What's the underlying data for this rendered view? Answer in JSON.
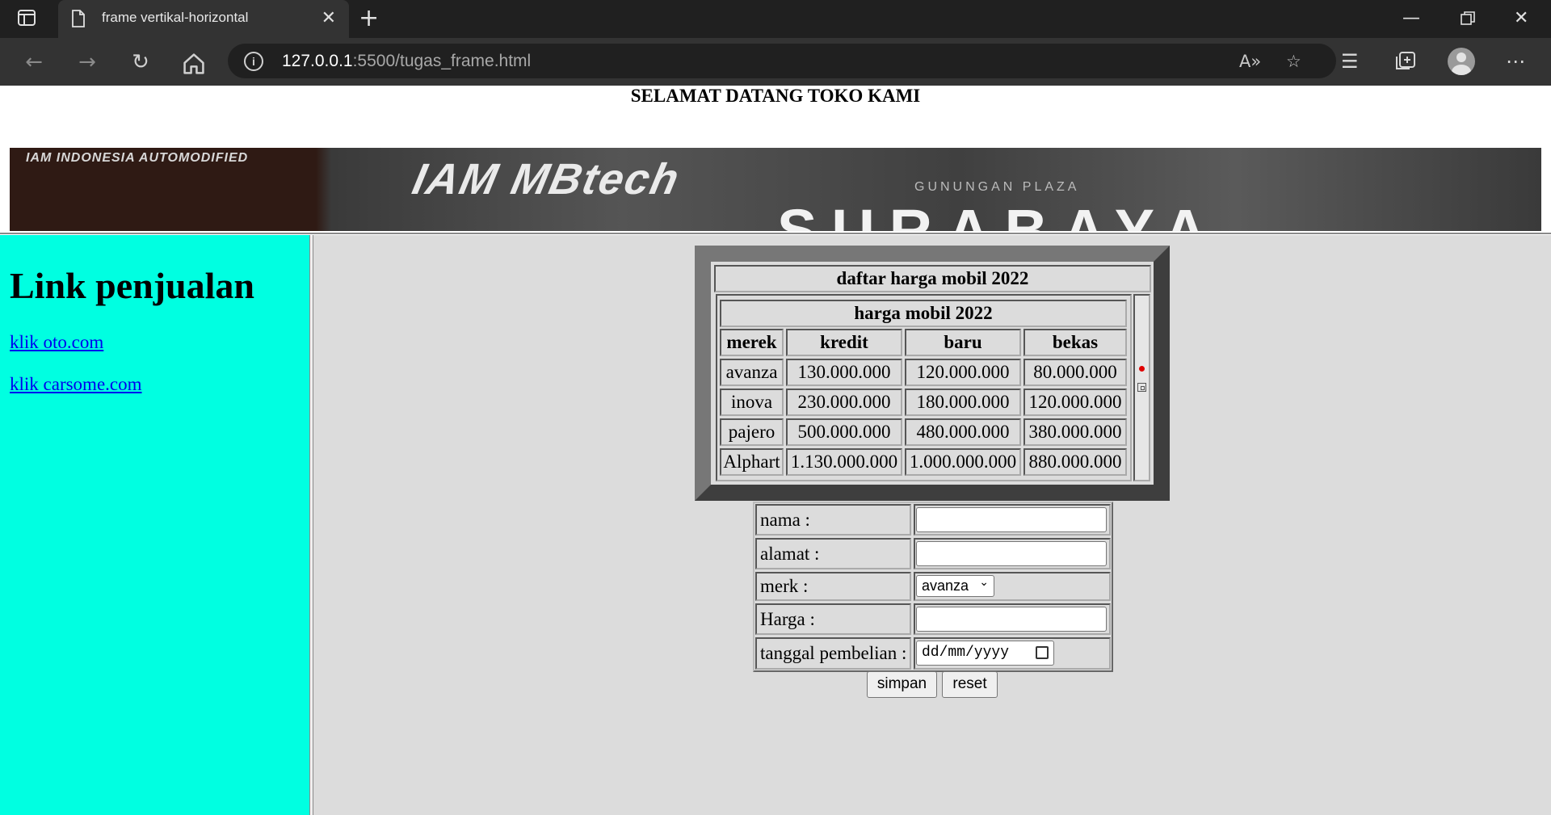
{
  "browser": {
    "tab_title": "frame vertikal-horizontal",
    "url_host": "127.0.0.1",
    "url_rest": ":5500/tugas_frame.html",
    "read_aloud_glyph": "A»"
  },
  "header": {
    "welcome": "SELAMAT DATANG TOKO KAMI",
    "banner_text_left": "IAM INDONESIA AUTOMODIFIED",
    "banner_text_mid": "IAM MBtech",
    "banner_text_small": "GUNUNGAN PLAZA",
    "banner_text_big": "SURABAYA"
  },
  "sidebar": {
    "heading": "Link penjualan",
    "links": [
      "klik oto.com",
      "klik carsome.com"
    ]
  },
  "price_table": {
    "caption": "daftar harga mobil 2022",
    "title": "harga mobil 2022",
    "columns": [
      "merek",
      "kredit",
      "baru",
      "bekas"
    ],
    "rows": [
      [
        "avanza",
        "130.000.000",
        "120.000.000",
        "80.000.000"
      ],
      [
        "inova",
        "230.000.000",
        "180.000.000",
        "120.000.000"
      ],
      [
        "pajero",
        "500.000.000",
        "480.000.000",
        "380.000.000"
      ],
      [
        "Alphart",
        "1.130.000.000",
        "1.000.000.000",
        "880.000.000"
      ]
    ]
  },
  "form": {
    "nama_label": "nama :",
    "nama_value": "",
    "alamat_label": "alamat :",
    "alamat_value": "",
    "merk_label": "merk :",
    "merk_selected": "avanza",
    "harga_label": "Harga :",
    "harga_value": "",
    "tanggal_label": "tanggal pembelian :",
    "tanggal_placeholder": "dd/mm/yyyy",
    "submit_label": "simpan",
    "reset_label": "reset"
  },
  "icons": [
    "sidebar-toggle-icon",
    "document-icon",
    "close-icon",
    "plus-icon",
    "minimize-icon",
    "restore-icon",
    "window-close-icon",
    "back-icon",
    "forward-icon",
    "refresh-icon",
    "home-icon",
    "info-icon",
    "read-aloud-icon",
    "add-favorite-icon",
    "favorites-icon",
    "collections-icon",
    "profile-avatar-icon",
    "more-icon",
    "calendar-icon",
    "chevron-down-icon"
  ]
}
